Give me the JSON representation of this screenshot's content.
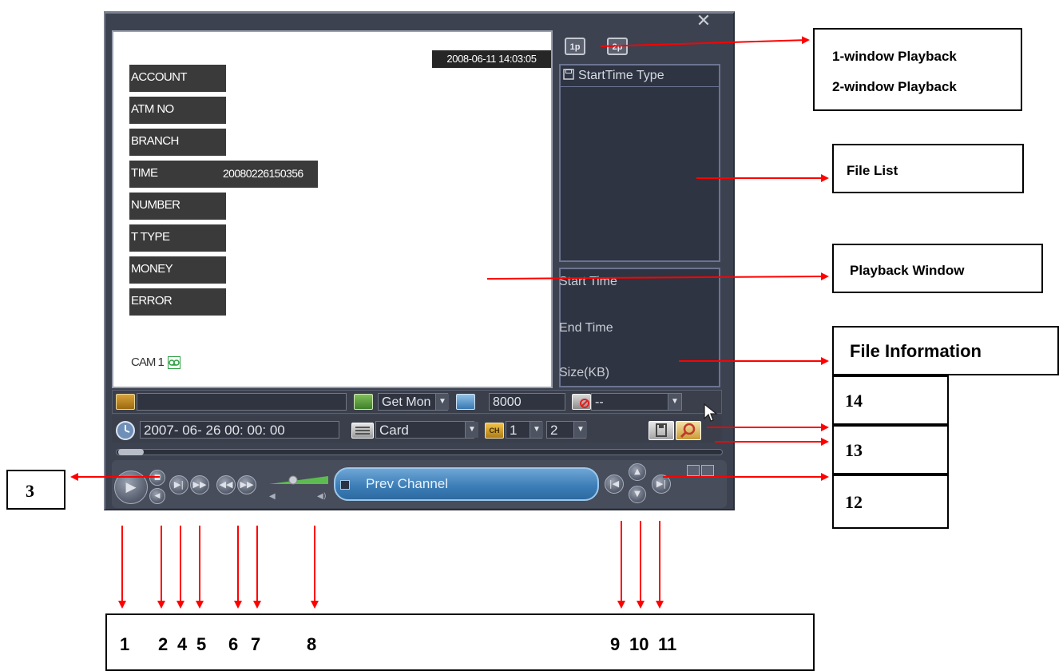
{
  "playback_window": {
    "osd_datetime": "2008-06-11 14:03:05",
    "overlay_fields": [
      {
        "label": "ACCOUNT",
        "value": ""
      },
      {
        "label": "ATM NO",
        "value": ""
      },
      {
        "label": "BRANCH",
        "value": ""
      },
      {
        "label": "TIME",
        "value": "20080226150356"
      },
      {
        "label": "NUMBER",
        "value": ""
      },
      {
        "label": "T TYPE",
        "value": ""
      },
      {
        "label": "MONEY",
        "value": ""
      },
      {
        "label": "ERROR",
        "value": ""
      }
    ],
    "camera_label": "CAM 1"
  },
  "right_panel": {
    "window_buttons": [
      "1p",
      "2p"
    ],
    "file_list_header": "StartTime Type",
    "file_info_labels": [
      "Start Time",
      "End Time",
      "Size(KB)"
    ]
  },
  "bar1": {
    "money_select": "Get Mon",
    "amount": "8000",
    "error_select": "--"
  },
  "bar2": {
    "datetime": "2007- 06- 26 00: 00: 00",
    "search_type": "Card",
    "channel": "1",
    "window_count": "2"
  },
  "controls": {
    "prev_channel_label": "Prev Channel"
  },
  "annotations": {
    "callouts": [
      "1-window Playback",
      "2-window Playback",
      "File List",
      "Playback Window",
      "File Information"
    ],
    "side_numbers": [
      "14",
      "13",
      "12"
    ],
    "left_number": "3",
    "bottom_numbers": [
      "1",
      "2",
      "4",
      "5",
      "6",
      "7",
      "8",
      "9",
      "10",
      "11"
    ]
  },
  "colors": {
    "accent": "#3e7fb8",
    "arrow": "#ff0000",
    "window_bg": "#3c4250"
  }
}
